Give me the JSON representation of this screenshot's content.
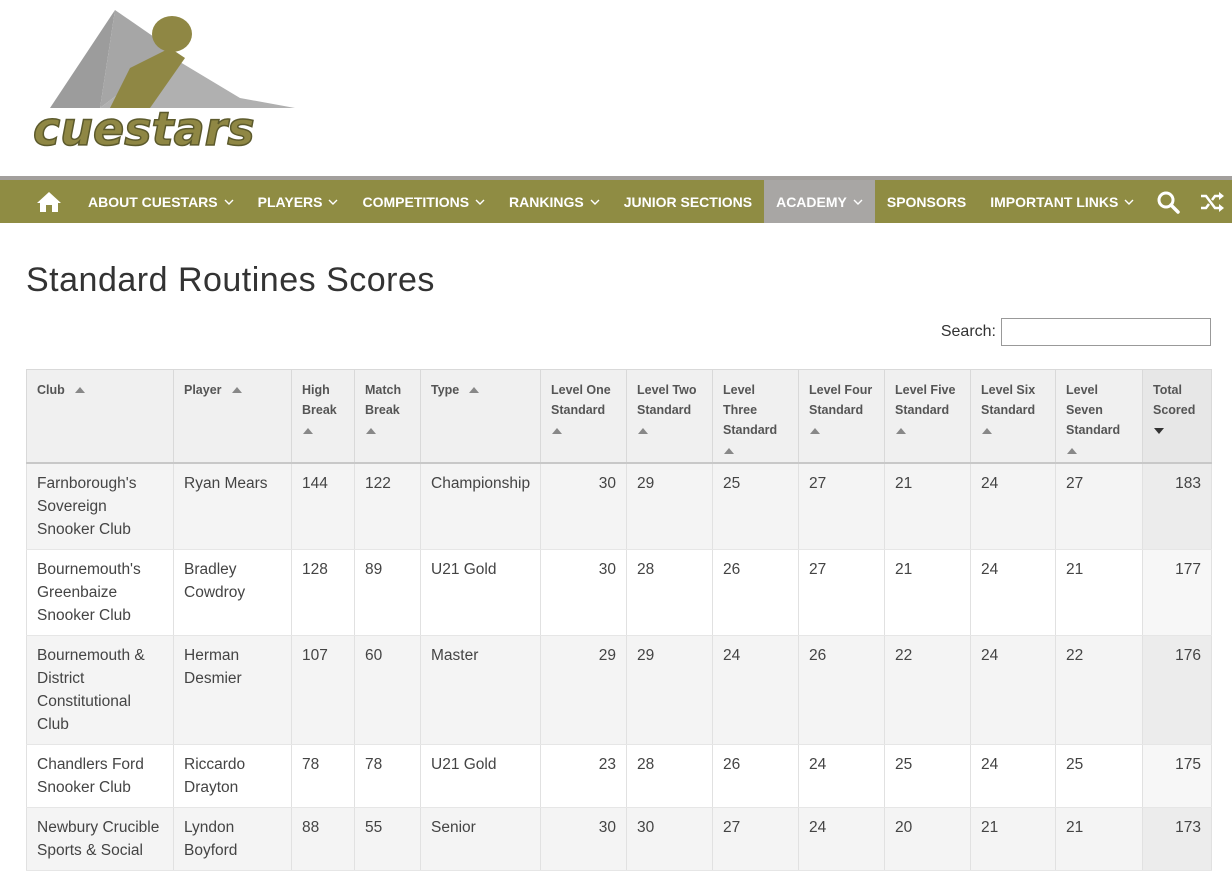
{
  "brand": {
    "name": "cuestars"
  },
  "nav": {
    "items": [
      {
        "label": "ABOUT CUESTARS",
        "dropdown": true,
        "active": false
      },
      {
        "label": "PLAYERS",
        "dropdown": true,
        "active": false
      },
      {
        "label": "COMPETITIONS",
        "dropdown": true,
        "active": false
      },
      {
        "label": "RANKINGS",
        "dropdown": true,
        "active": false
      },
      {
        "label": "JUNIOR SECTIONS",
        "dropdown": false,
        "active": false
      },
      {
        "label": "ACADEMY",
        "dropdown": true,
        "active": true
      },
      {
        "label": "SPONSORS",
        "dropdown": false,
        "active": false
      },
      {
        "label": "IMPORTANT LINKS",
        "dropdown": true,
        "active": false
      }
    ],
    "icons": [
      "home-icon",
      "search-icon",
      "shuffle-icon"
    ]
  },
  "page": {
    "title": "Standard Routines Scores"
  },
  "search": {
    "label": "Search:",
    "value": "",
    "placeholder": ""
  },
  "table": {
    "columns": [
      "Club",
      "Player",
      "High Break",
      "Match Break",
      "Type",
      "Level One Standard",
      "Level Two Standard",
      "Level Three Standard",
      "Level Four Standard",
      "Level Five Standard",
      "Level Six Standard",
      "Level Seven Standard",
      "Total Scored"
    ],
    "sorted_column": "Total Scored",
    "sort_direction": "descending",
    "rows": [
      {
        "club": "Farnborough's Sovereign Snooker Club",
        "player": "Ryan Mears",
        "high": "144",
        "match": "122",
        "type": "Championship",
        "l1": "30",
        "l2": "29",
        "l3": "25",
        "l4": "27",
        "l5": "21",
        "l6": "24",
        "l7": "27",
        "total": "183"
      },
      {
        "club": "Bournemouth's Greenbaize Snooker Club",
        "player": "Bradley Cowdroy",
        "high": "128",
        "match": "89",
        "type": "U21 Gold",
        "l1": "30",
        "l2": "28",
        "l3": "26",
        "l4": "27",
        "l5": "21",
        "l6": "24",
        "l7": "21",
        "total": "177"
      },
      {
        "club": "Bournemouth & District Constitutional Club",
        "player": "Herman Desmier",
        "high": "107",
        "match": "60",
        "type": "Master",
        "l1": "29",
        "l2": "29",
        "l3": "24",
        "l4": "26",
        "l5": "22",
        "l6": "24",
        "l7": "22",
        "total": "176"
      },
      {
        "club": "Chandlers Ford Snooker Club",
        "player": "Riccardo Drayton",
        "high": "78",
        "match": "78",
        "type": "U21 Gold",
        "l1": "23",
        "l2": "28",
        "l3": "26",
        "l4": "24",
        "l5": "25",
        "l6": "24",
        "l7": "25",
        "total": "175"
      },
      {
        "club": "Newbury Crucible Sports & Social",
        "player": "Lyndon Boyford",
        "high": "88",
        "match": "55",
        "type": "Senior",
        "l1": "30",
        "l2": "30",
        "l3": "27",
        "l4": "24",
        "l5": "20",
        "l6": "21",
        "l7": "21",
        "total": "173"
      }
    ]
  },
  "colors": {
    "nav_bg": "#8f8c43",
    "nav_active": "#a8a6a4",
    "logo_gold": "#8f8744",
    "logo_grey": "#9a9a9a"
  }
}
